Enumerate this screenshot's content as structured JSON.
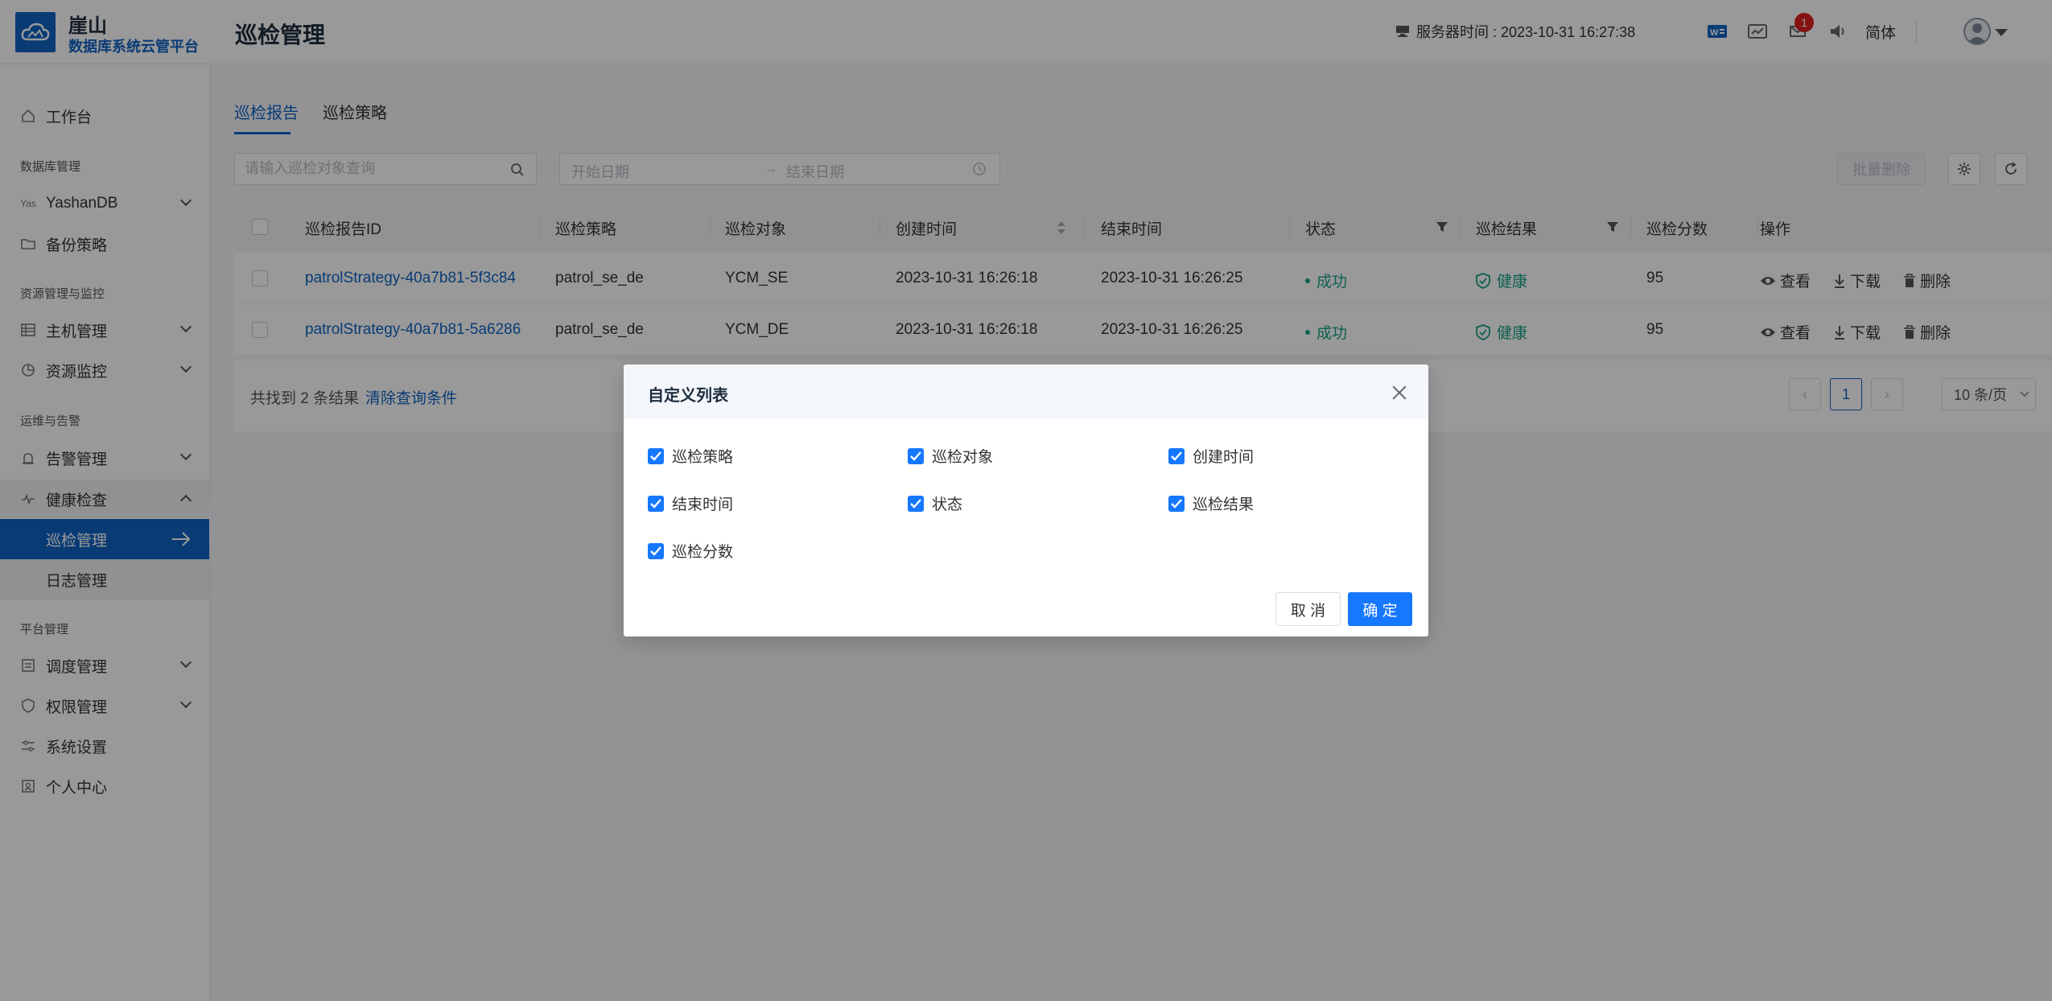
{
  "header": {
    "brand_name": "崖山",
    "brand_subtitle": "数据库系统云管平台",
    "page_title": "巡检管理",
    "server_time": "服务器时间 : 2023-10-31 16:27:38",
    "notification_count": "1",
    "language": "简体"
  },
  "sidebar": {
    "workbench": "工作台",
    "group_db": "数据库管理",
    "yashandb": "YashanDB",
    "backup": "备份策略",
    "group_resource": "资源管理与监控",
    "host": "主机管理",
    "resource_monitor": "资源监控",
    "group_ops": "运维与告警",
    "alarm": "告警管理",
    "health": "健康检查",
    "patrol": "巡检管理",
    "log": "日志管理",
    "group_platform": "平台管理",
    "schedule": "调度管理",
    "permission": "权限管理",
    "settings": "系统设置",
    "personal": "个人中心"
  },
  "tabs": {
    "report": "巡检报告",
    "strategy": "巡检策略"
  },
  "filters": {
    "search_placeholder": "请输入巡检对象查询",
    "start_date": "开始日期",
    "end_date": "结束日期",
    "batch_delete": "批量删除"
  },
  "table": {
    "headers": [
      "巡检报告ID",
      "巡检策略",
      "巡检对象",
      "创建时间",
      "结束时间",
      "状态",
      "巡检结果",
      "巡检分数",
      "操作"
    ],
    "rows": [
      {
        "id": "patrolStrategy-40a7b81-5f3c84",
        "strategy": "patrol_se_de",
        "object": "YCM_SE",
        "created": "2023-10-31 16:26:18",
        "ended": "2023-10-31 16:26:25",
        "status": "成功",
        "result": "健康",
        "score": "95"
      },
      {
        "id": "patrolStrategy-40a7b81-5a6286",
        "strategy": "patrol_se_de",
        "object": "YCM_DE",
        "created": "2023-10-31 16:26:18",
        "ended": "2023-10-31 16:26:25",
        "status": "成功",
        "result": "健康",
        "score": "95"
      }
    ],
    "actions": {
      "view": "查看",
      "download": "下载",
      "delete": "删除"
    }
  },
  "footer": {
    "total_prefix": "共找到",
    "total": "2",
    "total_suffix": "条结果",
    "clear": "清除查询条件",
    "current_page": "1",
    "page_size": "10 条/页"
  },
  "dialog": {
    "title": "自定义列表",
    "options": [
      {
        "label": "巡检策略",
        "checked": true
      },
      {
        "label": "巡检对象",
        "checked": true
      },
      {
        "label": "创建时间",
        "checked": true
      },
      {
        "label": "结束时间",
        "checked": true
      },
      {
        "label": "状态",
        "checked": true
      },
      {
        "label": "巡检结果",
        "checked": true
      },
      {
        "label": "巡检分数",
        "checked": true
      }
    ],
    "cancel": "取 消",
    "ok": "确 定"
  },
  "colors": {
    "primary": "#1063c4",
    "accent": "#1677ff",
    "success": "#16a085",
    "badge": "#e02020"
  }
}
